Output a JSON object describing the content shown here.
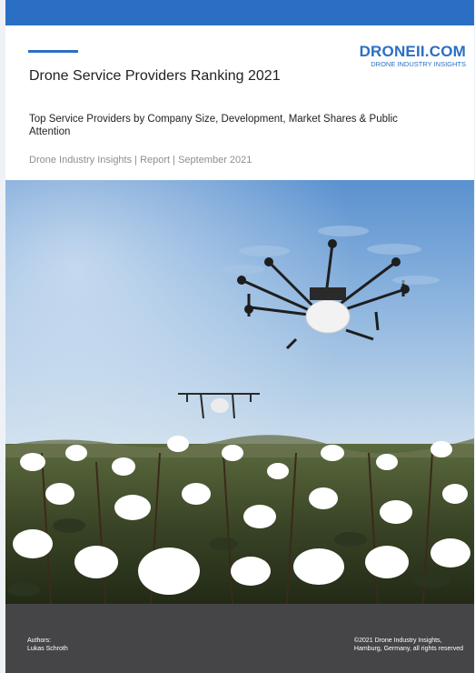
{
  "document": {
    "title": "Drone Service Providers Ranking 2021",
    "subtitle": "Top Service Providers by Company Size, Development, Market Shares & Public Attention",
    "meta": "Drone Industry Insights  |  Report  | September 2021"
  },
  "logo": {
    "main": "DRONEII.COM",
    "sub": "DRONE INDUSTRY INSIGHTS"
  },
  "footer": {
    "authors_label": "Authors:",
    "author_name": "Lukas Schroth",
    "copyright_line1": "©2021 Drone Industry Insights,",
    "copyright_line2": "Hamburg, Germany, all rights reserved"
  },
  "colors": {
    "brand_blue": "#2a6fc4",
    "footer_bg": "#454547"
  }
}
